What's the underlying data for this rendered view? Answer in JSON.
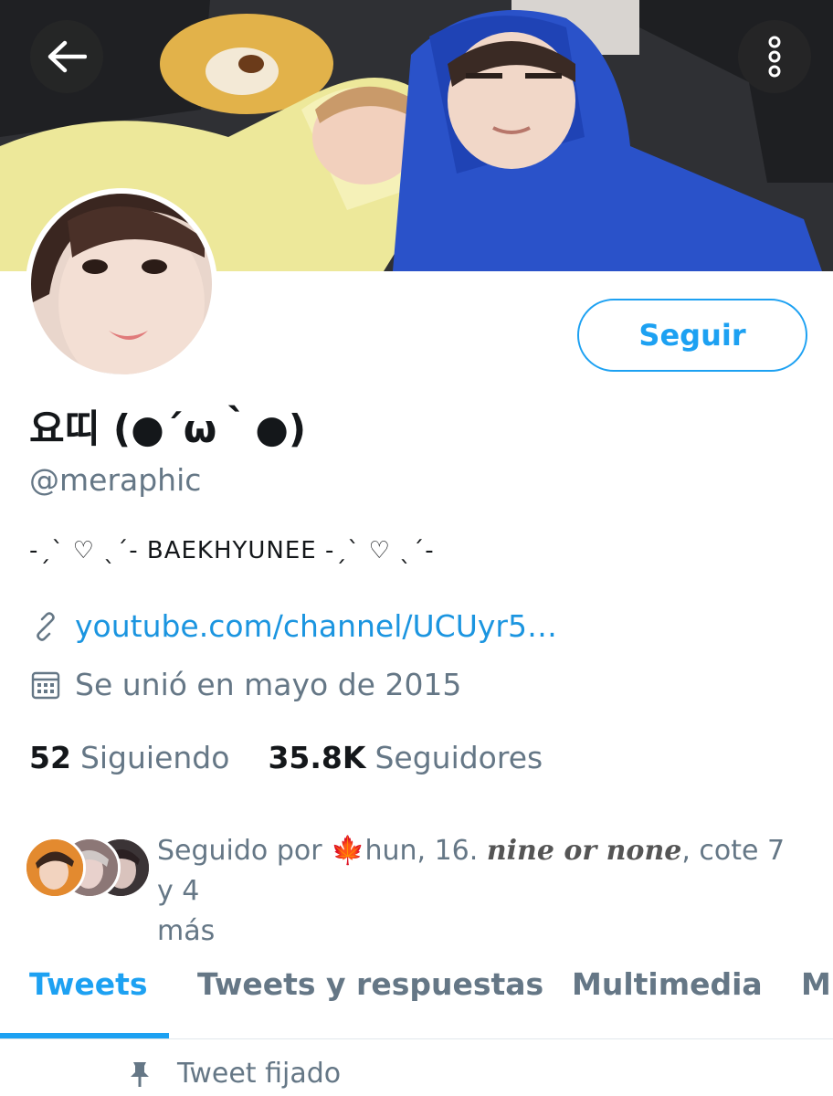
{
  "header": {
    "back_icon": "arrow-left-icon",
    "more_icon": "more-vertical-icon"
  },
  "profile": {
    "name": "요띠 (●´ω｀●)",
    "handle": "@meraphic",
    "bio": "-ˏˋ ♡ ˎˊ- BAEKHYUNEE  -ˏˋ ♡ ˎˊ-",
    "link": "youtube.com/channel/UCUyr5…",
    "joined": "Se unió en mayo de 2015",
    "follow_label": "Seguir"
  },
  "stats": {
    "following_count": "52",
    "following_label": "Siguiendo",
    "followers_count": "35.8K",
    "followers_label": "Seguidores"
  },
  "followed_by": {
    "prefix": "Seguido por ",
    "flag": "🍁",
    "name1": "hun, 16. ",
    "name2": "nine or none",
    "rest": ", cote 7 y 4",
    "more": "más"
  },
  "tabs": [
    "Tweets",
    "Tweets y respuestas",
    "Multimedia",
    "M"
  ],
  "pinned_label": "Tweet fijado",
  "colors": {
    "accent": "#1da1f2",
    "link": "#1b95e0",
    "secondary_text": "#657786"
  }
}
